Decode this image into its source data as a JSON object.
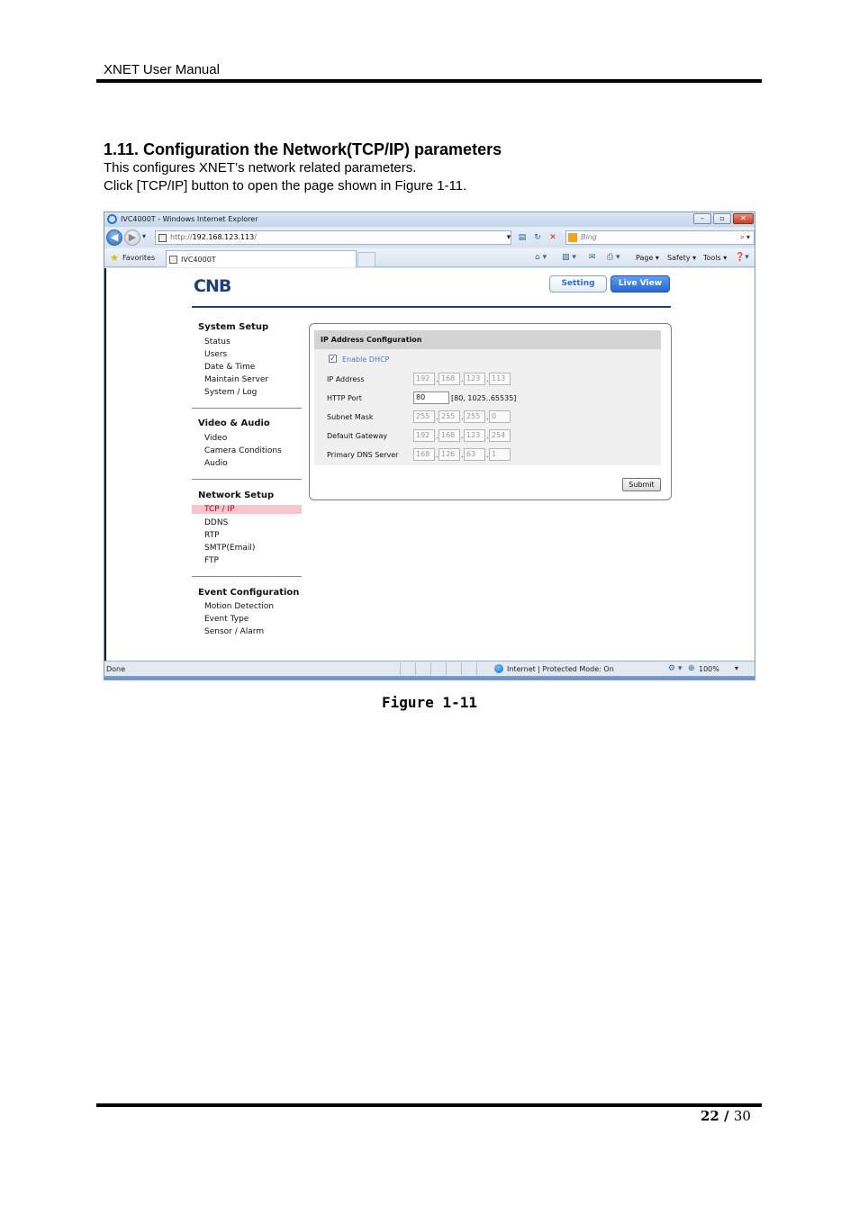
{
  "header": {
    "title": "XNET User Manual"
  },
  "section": {
    "title": "1.11. Configuration the Network(TCP/IP) parameters",
    "para1": "This configures XNET’s network related parameters.",
    "para2": "Click [TCP/IP] button to open the page shown in Figure 1-11."
  },
  "browser": {
    "window_title": "IVC4000T - Windows Internet Explorer",
    "url_prefix": "http://",
    "url_host": "192.168.123.113",
    "url_suffix": "/",
    "search_placeholder": "Bing",
    "favorites_label": "Favorites",
    "tab_title": "IVC4000T",
    "commands": {
      "page": "Page ▾",
      "safety": "Safety ▾",
      "tools": "Tools ▾"
    },
    "status_text": "Done",
    "status_zone": "Internet | Protected Mode: On",
    "zoom": "100%"
  },
  "app": {
    "logo": "CNB",
    "setting_button": "Setting",
    "liveview_button": "Live View",
    "menu": {
      "system": {
        "title": "System Setup",
        "items": [
          "Status",
          "Users",
          "Date & Time",
          "Maintain Server",
          "System / Log"
        ]
      },
      "video": {
        "title": "Video & Audio",
        "items": [
          "Video",
          "Camera Conditions",
          "Audio"
        ]
      },
      "network": {
        "title": "Network Setup",
        "items": [
          "TCP / IP",
          "DDNS",
          "RTP",
          "SMTP(Email)",
          "FTP"
        ]
      },
      "event": {
        "title": "Event Configuration",
        "items": [
          "Motion Detection",
          "Event Type",
          "Sensor / Alarm"
        ]
      }
    },
    "ip_config": {
      "title": "IP Address Configuration",
      "dhcp_label": "Enable DHCP",
      "dhcp_checked": true,
      "ip_label": "IP Address",
      "ip": [
        "192",
        "168",
        "123",
        "113"
      ],
      "http_label": "HTTP Port",
      "http_port": "80",
      "http_range": "[80, 1025..65535]",
      "subnet_label": "Subnet Mask",
      "subnet": [
        "255",
        "255",
        "255",
        "0"
      ],
      "gateway_label": "Default Gateway",
      "gateway": [
        "192",
        "168",
        "123",
        "254"
      ],
      "dns_label": "Primary DNS Server",
      "dns": [
        "168",
        "126",
        "63",
        "1"
      ],
      "submit": "Submit"
    }
  },
  "figure": {
    "caption": "Figure 1-11"
  },
  "footer": {
    "page": "22",
    "sep": " / ",
    "total": "30"
  }
}
